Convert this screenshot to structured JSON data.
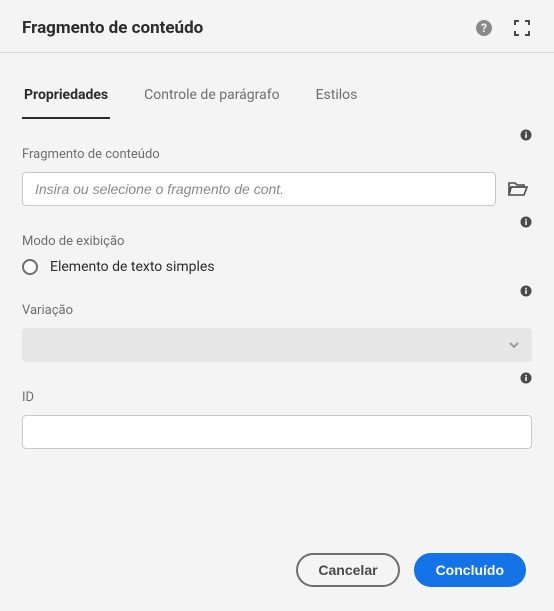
{
  "header": {
    "title": "Fragmento de conteúdo"
  },
  "tabs": [
    {
      "label": "Propriedades",
      "active": true
    },
    {
      "label": "Controle de parágrafo",
      "active": false
    },
    {
      "label": "Estilos",
      "active": false
    }
  ],
  "fields": {
    "fragment": {
      "label": "Fragmento de conteúdo",
      "placeholder": "Insira ou selecione o fragmento de cont.",
      "value": ""
    },
    "displayMode": {
      "label": "Modo de exibição",
      "option": "Elemento de texto simples"
    },
    "variation": {
      "label": "Variação",
      "value": ""
    },
    "id": {
      "label": "ID",
      "value": ""
    }
  },
  "footer": {
    "cancel": "Cancelar",
    "done": "Concluído"
  }
}
